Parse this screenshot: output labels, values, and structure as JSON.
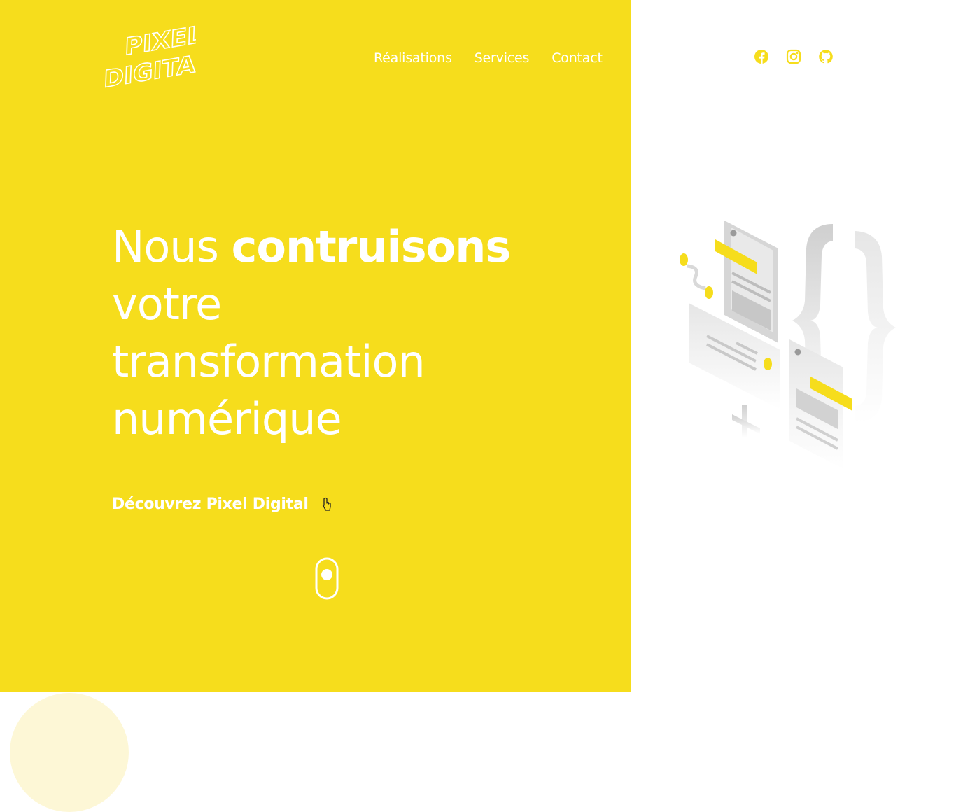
{
  "brand": {
    "logo_text_line1": "PIXEL",
    "logo_text_line2": "DIGITAL",
    "accent_color": "#f6dd1c"
  },
  "nav": {
    "items": [
      {
        "label": "Réalisations"
      },
      {
        "label": "Services"
      },
      {
        "label": "Contact"
      }
    ]
  },
  "social": {
    "icons": [
      "facebook-icon",
      "instagram-icon",
      "github-icon"
    ]
  },
  "hero": {
    "headline_part1": "Nous ",
    "headline_bold": "contruisons",
    "headline_line2": "votre",
    "headline_line3": "transformation",
    "headline_line4": "numérique",
    "cta_label": "Découvrez Pixel Digital"
  }
}
